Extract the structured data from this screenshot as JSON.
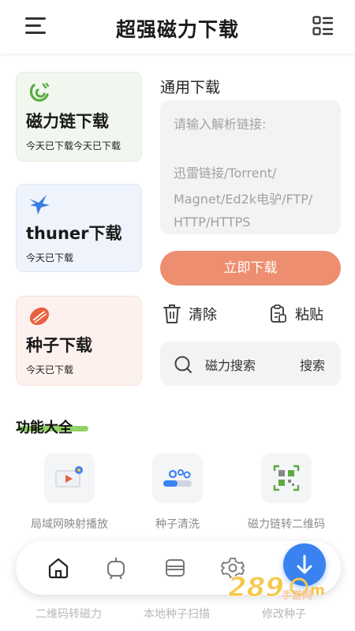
{
  "header": {
    "title": "超强磁力下载",
    "menu_icon": "hamburger-menu-icon",
    "list_icon": "list-view-icon"
  },
  "cards": [
    {
      "title": "磁力链下载",
      "subtitle": "今天已下载今天已下载",
      "icon": "magnet-icon",
      "color": "#5aab3f"
    },
    {
      "title": "thuner下载",
      "subtitle": "今天已下载",
      "icon": "thunder-bird-icon",
      "color": "#3a7de8"
    },
    {
      "title": "种子下载",
      "subtitle": "今天已下载",
      "icon": "seed-icon",
      "color": "#e8603e"
    }
  ],
  "general": {
    "label": "通用下载",
    "placeholder_lines": [
      "请输入解析链接:",
      "",
      "迅雷链接/Torrent/",
      "Magnet/Ed2k电驴/FTP/",
      "HTTP/HTTPS"
    ],
    "download_button": "立即下载",
    "clear_label": "清除",
    "paste_label": "粘贴",
    "search_label": "磁力搜索",
    "search_button": "搜索"
  },
  "features": {
    "title": "功能大全",
    "items": [
      {
        "label": "局域网映射播放",
        "icon": "cast-play-icon"
      },
      {
        "label": "种子清洗",
        "icon": "seed-clean-icon"
      },
      {
        "label": "磁力链转二维码",
        "icon": "qr-code-icon"
      }
    ],
    "row2": [
      "二维码转磁力",
      "本地种子扫描",
      "修改种子"
    ]
  },
  "nav": {
    "items": [
      "home-icon",
      "tv-icon",
      "list-icon",
      "gear-icon"
    ],
    "fab_icon": "download-arrow-icon"
  },
  "watermark": {
    "text": "手游网",
    "digits": "289"
  },
  "colors": {
    "accent_orange": "#ed8e70",
    "fab_blue": "#3a82f0",
    "underline_green": "#7fc94b"
  }
}
